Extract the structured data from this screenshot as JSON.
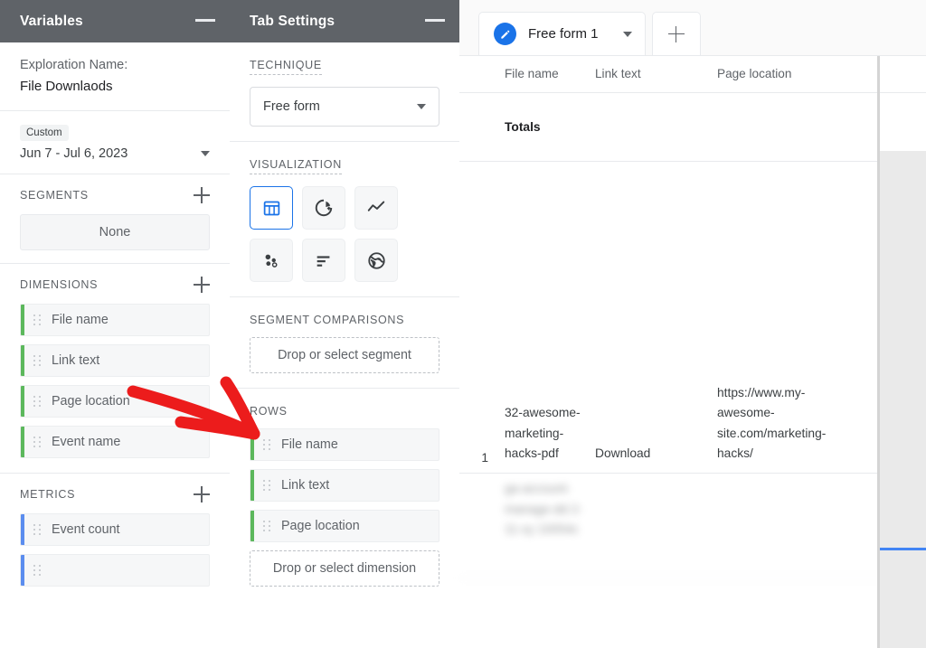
{
  "variables_panel": {
    "title": "Variables",
    "minimize_icon": "minimize-icon",
    "exploration_label": "Exploration Name:",
    "exploration_name": "File Downlaods",
    "date_badge": "Custom",
    "date_range": "Jun 7 - Jul 6, 2023",
    "segments": {
      "title": "SEGMENTS",
      "add_icon": "plus-icon",
      "items": [
        {
          "label": "None"
        }
      ]
    },
    "dimensions": {
      "title": "DIMENSIONS",
      "add_icon": "plus-icon",
      "items": [
        {
          "label": "File name"
        },
        {
          "label": "Link text"
        },
        {
          "label": "Page location"
        },
        {
          "label": "Event name"
        }
      ]
    },
    "metrics": {
      "title": "METRICS",
      "add_icon": "plus-icon",
      "items": [
        {
          "label": "Event count"
        },
        {
          "label": ""
        }
      ]
    }
  },
  "tab_settings_panel": {
    "title": "Tab Settings",
    "minimize_icon": "minimize-icon",
    "technique": {
      "label": "TECHNIQUE",
      "selected": "Free form",
      "caret_icon": "chevron-down-icon"
    },
    "visualization": {
      "label": "VISUALIZATION",
      "options": [
        {
          "icon": "table-icon",
          "selected": true
        },
        {
          "icon": "donut-chart-icon",
          "selected": false
        },
        {
          "icon": "line-chart-icon",
          "selected": false
        },
        {
          "icon": "scatter-plot-icon",
          "selected": false
        },
        {
          "icon": "bar-chart-icon",
          "selected": false
        },
        {
          "icon": "globe-icon",
          "selected": false
        }
      ]
    },
    "segment_comparisons": {
      "label": "SEGMENT COMPARISONS",
      "dropzone": "Drop or select segment"
    },
    "rows": {
      "label": "ROWS",
      "items": [
        {
          "label": "File name"
        },
        {
          "label": "Link text"
        },
        {
          "label": "Page location"
        }
      ],
      "dropzone": "Drop or select dimension"
    }
  },
  "canvas": {
    "tab": {
      "edit_icon": "pencil-icon",
      "name": "Free form 1",
      "caret_icon": "chevron-down-icon"
    },
    "add_tab_icon": "plus-icon",
    "table": {
      "columns": [
        "File name",
        "Link text",
        "Page location"
      ],
      "totals_label": "Totals",
      "rows": [
        {
          "index": "1",
          "file_name": "32-awesome-marketing-hacks-pdf",
          "link_text": "Download",
          "page_location": "https://www.my-awesome-site.com/marketing-hacks/",
          "blurred": false
        },
        {
          "index": "",
          "file_name": "ga-account-manage-dd 2-11-xy 10054c",
          "link_text": "",
          "page_location": "",
          "blurred": true
        }
      ]
    }
  },
  "annotation": {
    "arrow_icon": "red-arrow-annotation",
    "color": "#ec1c1c"
  },
  "colors": {
    "panel_header": "#5f6368",
    "dimension_accent": "#5cb85c",
    "metric_accent": "#5b8def",
    "selected_viz": "#1a73e8",
    "tab_icon": "#1a73e8",
    "scroll_highlight": "#4285f4"
  }
}
